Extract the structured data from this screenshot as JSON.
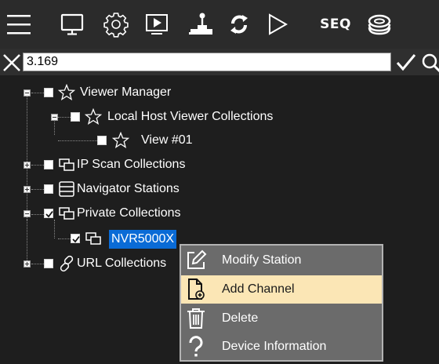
{
  "toolbar": {
    "buttons": [
      {
        "name": "menu-icon"
      },
      {
        "name": "monitor-icon"
      },
      {
        "name": "gear-icon"
      },
      {
        "name": "play-screen-icon"
      },
      {
        "name": "joystick-icon"
      },
      {
        "name": "refresh-icon"
      },
      {
        "name": "play-icon"
      },
      {
        "name": "seq-button",
        "label": "SEQ"
      },
      {
        "name": "disc-stack-icon"
      }
    ]
  },
  "search": {
    "value": "3.169"
  },
  "tree": {
    "items": [
      {
        "label": "Viewer Manager",
        "expander": "minus",
        "checked": false,
        "icon": "star-icon"
      },
      {
        "label": "Local Host Viewer Collections",
        "expander": "minus",
        "checked": false,
        "icon": "star-icon"
      },
      {
        "label": "View #01",
        "checked": false,
        "icon": "star-icon"
      },
      {
        "label": "IP Scan Collections",
        "expander": "plus",
        "checked": false,
        "icon": "windows-icon"
      },
      {
        "label": "Navigator Stations",
        "expander": "plus",
        "checked": false,
        "icon": "server-icon"
      },
      {
        "label": "Private Collections",
        "expander": "minus",
        "checked": true,
        "icon": "windows-icon"
      },
      {
        "label": "NVR5000X",
        "checked": true,
        "icon": "windows-icon",
        "selected": true
      },
      {
        "label": "URL Collections",
        "expander": "plus",
        "checked": false,
        "icon": "link-icon"
      }
    ]
  },
  "context_menu": {
    "items": [
      {
        "label": "Modify Station",
        "icon": "edit-icon",
        "highlighted": false
      },
      {
        "label": "Add Channel",
        "icon": "add-file-icon",
        "highlighted": true
      },
      {
        "label": "Delete",
        "icon": "trash-icon",
        "highlighted": false
      },
      {
        "label": "Device Information",
        "icon": "question-icon",
        "highlighted": false
      }
    ]
  },
  "colors": {
    "toolbar_bg": "#2b2b2b",
    "tree_bg": "#1e1e1e",
    "selection": "#0a6bd6",
    "menu_bg": "#6b6b6b",
    "menu_highlight": "#fbe6b5"
  }
}
